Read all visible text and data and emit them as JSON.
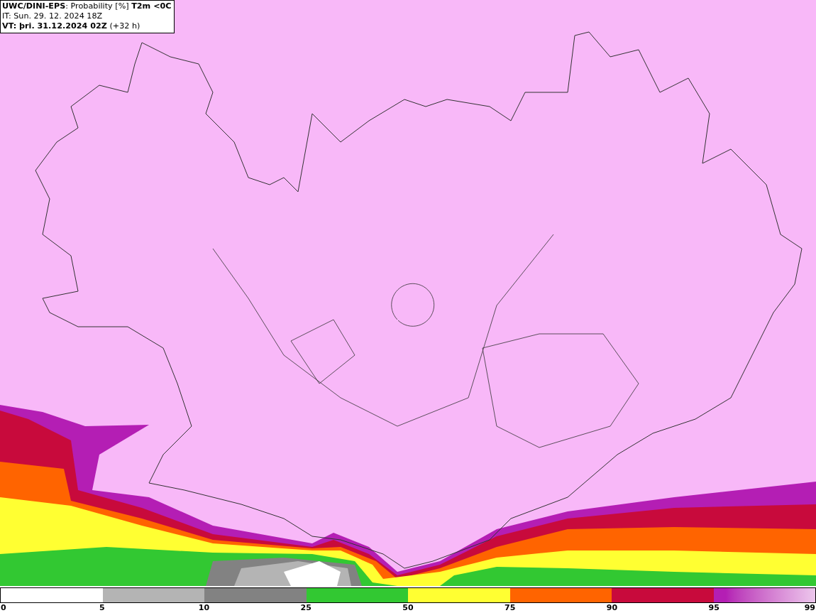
{
  "header": {
    "lines": [
      "**UWC/DINI-EPS**: Probability [%] **T2m <0C**",
      "IT: Sun. 29. 12. 2024 18Z",
      "**VT: þri. 31.12.2024 02Z** (+32 h)"
    ]
  },
  "legend": {
    "segments": [
      {
        "color": "#ffffff"
      },
      {
        "color": "#b4b4b4"
      },
      {
        "color": "#828282"
      },
      {
        "color": "#32c832"
      },
      {
        "color": "#ffff32"
      },
      {
        "color": "#ff6400"
      },
      {
        "color": "#c80a3c"
      },
      {
        "color": "#b41eb4",
        "kind": "gradient"
      }
    ],
    "ticks": [
      "0",
      "5",
      "10",
      "25",
      "50",
      "75",
      "90",
      "95",
      "99"
    ]
  }
}
